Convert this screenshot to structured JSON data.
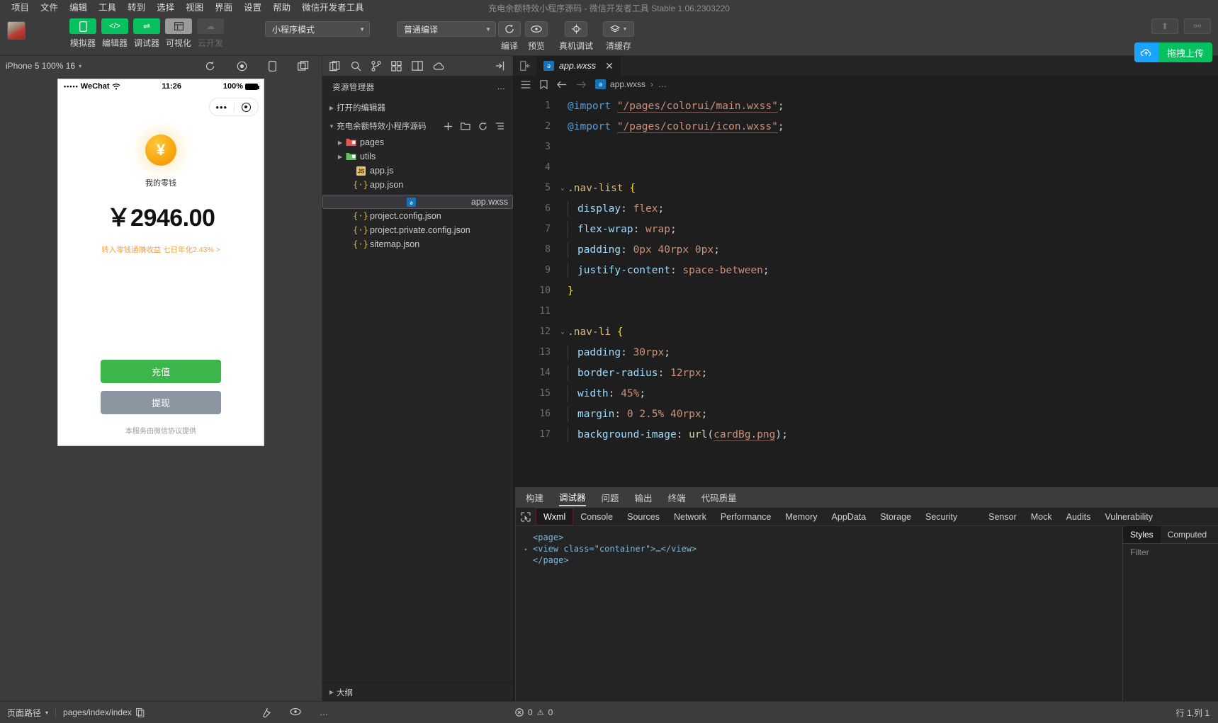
{
  "window": {
    "title": "充电余额特效小程序源码 - 微信开发者工具 Stable 1.06.2303220"
  },
  "menubar": {
    "items": [
      "项目",
      "文件",
      "编辑",
      "工具",
      "转到",
      "选择",
      "视图",
      "界面",
      "设置",
      "帮助",
      "微信开发者工具"
    ]
  },
  "toolbar": {
    "mode_buttons": [
      {
        "label": "模拟器",
        "icon": "phone-icon",
        "glyph": "▯",
        "style": "green"
      },
      {
        "label": "编辑器",
        "icon": "code-icon",
        "glyph": "</>",
        "style": "green"
      },
      {
        "label": "调试器",
        "icon": "debug-icon",
        "glyph": "⇌",
        "style": "green"
      },
      {
        "label": "可视化",
        "icon": "layout-icon",
        "glyph": "▤",
        "style": "grey"
      },
      {
        "label": "云开发",
        "icon": "cloud-icon",
        "glyph": "☁",
        "style": "dim"
      }
    ],
    "mode_select": {
      "value": "小程序模式",
      "caret": "▼"
    },
    "compile_select": {
      "value": "普通编译",
      "caret": "▼"
    },
    "action_buttons": [
      {
        "label": "编译",
        "icon": "refresh-icon",
        "glyph": "⟳"
      },
      {
        "label": "预览",
        "icon": "eye-icon",
        "glyph": "◉"
      },
      {
        "label": "真机调试",
        "icon": "bug-icon",
        "glyph": "✱"
      },
      {
        "label": "清缓存",
        "icon": "layers-icon",
        "glyph": "≋"
      }
    ],
    "upload_button": {
      "label": "拖拽上传",
      "icon": "cloud-upload-icon"
    },
    "right_icons": [
      {
        "icon": "upload-icon",
        "glyph": "⬆"
      },
      {
        "icon": "user-icon",
        "glyph": "⚯"
      }
    ]
  },
  "simulator": {
    "device_label": "iPhone 5 100% 16",
    "device_caret": "▾",
    "icons": [
      {
        "icon": "rotate-icon",
        "glyph": "⟳"
      },
      {
        "icon": "record-icon",
        "glyph": "◉"
      },
      {
        "icon": "device-icon",
        "glyph": "▯"
      },
      {
        "icon": "multi-window-icon",
        "glyph": "❐"
      }
    ],
    "status_bar": {
      "carrier_dots": "•••••",
      "carrier": "WeChat",
      "wifi": "⌃",
      "time": "11:26",
      "battery": "100%"
    },
    "capsule": {
      "dots": "•••",
      "target_icon": "target-icon"
    },
    "page": {
      "coin_icon": "yuan-coin-icon",
      "coin_glyph": "¥",
      "label": "我的零钱",
      "amount": "￥2946.00",
      "yield_line": "转入零钱通赚收益 七日年化2.43% >",
      "primary_button": "充值",
      "secondary_button": "提现",
      "footnote": "本服务由微信协议提供"
    }
  },
  "explorer": {
    "toolbar_icons": [
      {
        "icon": "files-icon",
        "glyph": "❐"
      },
      {
        "icon": "search-icon",
        "glyph": "⌕"
      },
      {
        "icon": "source-control-icon",
        "glyph": "⑂"
      },
      {
        "icon": "extensions-icon",
        "glyph": "⊞"
      },
      {
        "icon": "open-editors-icon",
        "glyph": "❏"
      },
      {
        "icon": "cloud-icon",
        "glyph": "☁"
      },
      {
        "icon": "collapse-icon",
        "glyph": "⇥"
      }
    ],
    "title": "资源管理器",
    "more_icon": "…",
    "sections": [
      {
        "label": "打开的编辑器",
        "expanded": false,
        "caret": "▶"
      },
      {
        "label": "充电余额特效小程序源码",
        "expanded": true,
        "caret": "▼",
        "actions": [
          {
            "icon": "new-file-icon",
            "glyph": "＋"
          },
          {
            "icon": "new-folder-icon",
            "glyph": "🗀"
          },
          {
            "icon": "refresh-icon",
            "glyph": "⟳"
          },
          {
            "icon": "collapse-all-icon",
            "glyph": "⇱"
          }
        ]
      }
    ],
    "files": [
      {
        "name": "pages",
        "type": "folder",
        "caret": "▶",
        "icon": "folder-red-icon",
        "indent": 1,
        "selected": false
      },
      {
        "name": "utils",
        "type": "folder",
        "caret": "▶",
        "icon": "folder-green-icon",
        "indent": 1,
        "selected": false
      },
      {
        "name": "app.js",
        "type": "js",
        "caret": "",
        "icon": "js-file-icon",
        "indent": 2,
        "selected": false
      },
      {
        "name": "app.json",
        "type": "json",
        "caret": "",
        "icon": "json-file-icon",
        "indent": 2,
        "selected": false
      },
      {
        "name": "app.wxss",
        "type": "wxss",
        "caret": "",
        "icon": "wxss-file-icon",
        "indent": 2,
        "selected": true
      },
      {
        "name": "project.config.json",
        "type": "json",
        "caret": "",
        "icon": "json-file-icon",
        "indent": 2,
        "selected": false
      },
      {
        "name": "project.private.config.json",
        "type": "json",
        "caret": "",
        "icon": "json-file-icon",
        "indent": 2,
        "selected": false
      },
      {
        "name": "sitemap.json",
        "type": "json",
        "caret": "",
        "icon": "json-file-icon",
        "indent": 2,
        "selected": false
      }
    ],
    "footer": {
      "label": "大纲",
      "caret": "▶"
    }
  },
  "editor": {
    "split_icon": "split-editor-icon",
    "tab": {
      "name": "app.wxss",
      "icon": "wxss-file-icon",
      "close": "✕"
    },
    "breadcrumb_icons": [
      {
        "icon": "list-icon",
        "glyph": "☰"
      },
      {
        "icon": "bookmark-icon",
        "glyph": "🔖"
      },
      {
        "icon": "back-arrow-icon",
        "glyph": "←"
      },
      {
        "icon": "forward-arrow-icon",
        "glyph": "→"
      }
    ],
    "breadcrumb": {
      "file": "app.wxss",
      "sep": "›",
      "trail": "…"
    },
    "lines": [
      {
        "n": 1,
        "fold": "",
        "tokens": [
          {
            "t": "@import",
            "c": "kw"
          },
          {
            "t": " ",
            "c": "pun"
          },
          {
            "t": "\"/pages/colorui/main.wxss\"",
            "c": "str underline"
          },
          {
            "t": ";",
            "c": "pun"
          }
        ]
      },
      {
        "n": 2,
        "fold": "",
        "tokens": [
          {
            "t": "@import",
            "c": "kw"
          },
          {
            "t": " ",
            "c": "pun"
          },
          {
            "t": "\"/pages/colorui/icon.wxss\"",
            "c": "str underline"
          },
          {
            "t": ";",
            "c": "pun"
          }
        ]
      },
      {
        "n": 3,
        "fold": "",
        "tokens": []
      },
      {
        "n": 4,
        "fold": "",
        "tokens": []
      },
      {
        "n": 5,
        "fold": "⌄",
        "tokens": [
          {
            "t": ".nav-list",
            "c": "sel-c"
          },
          {
            "t": " ",
            "c": "pun"
          },
          {
            "t": "{",
            "c": "brace"
          }
        ]
      },
      {
        "n": 6,
        "fold": "",
        "indent": 1,
        "tokens": [
          {
            "t": "display",
            "c": "prop"
          },
          {
            "t": ": ",
            "c": "pun"
          },
          {
            "t": "flex",
            "c": "val"
          },
          {
            "t": ";",
            "c": "pun"
          }
        ]
      },
      {
        "n": 7,
        "fold": "",
        "indent": 1,
        "tokens": [
          {
            "t": "flex-wrap",
            "c": "prop"
          },
          {
            "t": ": ",
            "c": "pun"
          },
          {
            "t": "wrap",
            "c": "val"
          },
          {
            "t": ";",
            "c": "pun"
          }
        ]
      },
      {
        "n": 8,
        "fold": "",
        "indent": 1,
        "tokens": [
          {
            "t": "padding",
            "c": "prop"
          },
          {
            "t": ": ",
            "c": "pun"
          },
          {
            "t": "0px 40rpx 0px",
            "c": "val"
          },
          {
            "t": ";",
            "c": "pun"
          }
        ]
      },
      {
        "n": 9,
        "fold": "",
        "indent": 1,
        "tokens": [
          {
            "t": "justify-content",
            "c": "prop"
          },
          {
            "t": ": ",
            "c": "pun"
          },
          {
            "t": "space-between",
            "c": "val"
          },
          {
            "t": ";",
            "c": "pun"
          }
        ]
      },
      {
        "n": 10,
        "fold": "",
        "tokens": [
          {
            "t": "}",
            "c": "brace"
          }
        ]
      },
      {
        "n": 11,
        "fold": "",
        "tokens": []
      },
      {
        "n": 12,
        "fold": "⌄",
        "tokens": [
          {
            "t": ".nav-li",
            "c": "sel-c"
          },
          {
            "t": " ",
            "c": "pun"
          },
          {
            "t": "{",
            "c": "brace"
          }
        ]
      },
      {
        "n": 13,
        "fold": "",
        "indent": 1,
        "tokens": [
          {
            "t": "padding",
            "c": "prop"
          },
          {
            "t": ": ",
            "c": "pun"
          },
          {
            "t": "30rpx",
            "c": "val"
          },
          {
            "t": ";",
            "c": "pun"
          }
        ]
      },
      {
        "n": 14,
        "fold": "",
        "indent": 1,
        "tokens": [
          {
            "t": "border-radius",
            "c": "prop"
          },
          {
            "t": ": ",
            "c": "pun"
          },
          {
            "t": "12rpx",
            "c": "val"
          },
          {
            "t": ";",
            "c": "pun"
          }
        ]
      },
      {
        "n": 15,
        "fold": "",
        "indent": 1,
        "tokens": [
          {
            "t": "width",
            "c": "prop"
          },
          {
            "t": ": ",
            "c": "pun"
          },
          {
            "t": "45%",
            "c": "val"
          },
          {
            "t": ";",
            "c": "pun"
          }
        ]
      },
      {
        "n": 16,
        "fold": "",
        "indent": 1,
        "tokens": [
          {
            "t": "margin",
            "c": "prop"
          },
          {
            "t": ": ",
            "c": "pun"
          },
          {
            "t": "0 2.5% 40rpx",
            "c": "val"
          },
          {
            "t": ";",
            "c": "pun"
          }
        ]
      },
      {
        "n": 17,
        "fold": "",
        "indent": 1,
        "tokens": [
          {
            "t": "background-image",
            "c": "prop"
          },
          {
            "t": ": ",
            "c": "pun"
          },
          {
            "t": "url",
            "c": "fn"
          },
          {
            "t": "(",
            "c": "pun"
          },
          {
            "t": "cardBg.png",
            "c": "val underline"
          },
          {
            "t": ")",
            "c": "pun"
          },
          {
            "t": ";",
            "c": "pun"
          }
        ]
      }
    ]
  },
  "devtools": {
    "top_tabs": [
      {
        "label": "构建",
        "active": false
      },
      {
        "label": "调试器",
        "active": true
      },
      {
        "label": "问题",
        "active": false
      },
      {
        "label": "输出",
        "active": false
      },
      {
        "label": "终端",
        "active": false
      },
      {
        "label": "代码质量",
        "active": false
      }
    ],
    "picker_icon": "element-picker-icon",
    "panel_tabs": [
      {
        "label": "Wxml",
        "active": true
      },
      {
        "label": "Console",
        "active": false
      },
      {
        "label": "Sources",
        "active": false
      },
      {
        "label": "Network",
        "active": false
      },
      {
        "label": "Performance",
        "active": false
      },
      {
        "label": "Memory",
        "active": false
      },
      {
        "label": "AppData",
        "active": false
      },
      {
        "label": "Storage",
        "active": false
      },
      {
        "label": "Security",
        "active": false
      },
      {
        "label": "Sensor",
        "active": false
      },
      {
        "label": "Mock",
        "active": false
      },
      {
        "label": "Audits",
        "active": false
      },
      {
        "label": "Vulnerability",
        "active": false
      }
    ],
    "wxml_lines": [
      {
        "twisty": "",
        "html": "&lt;page&gt;"
      },
      {
        "twisty": "▸",
        "html": "&lt;view class=\"container\"&gt;…&lt;/view&gt;"
      },
      {
        "twisty": "",
        "html": "&lt;/page&gt;"
      }
    ],
    "styles_tabs": [
      {
        "label": "Styles",
        "active": true
      },
      {
        "label": "Computed",
        "active": false
      }
    ],
    "filter_placeholder": "Filter"
  },
  "statusbar": {
    "path_label": "页面路径",
    "path_caret": "▾",
    "path_value": "pages/index/index",
    "copy_icon": "copy-icon",
    "right_icons": [
      {
        "icon": "devtools-icon",
        "glyph": "⚒"
      },
      {
        "icon": "eye-icon",
        "glyph": "◉"
      },
      {
        "icon": "more-icon",
        "glyph": "…"
      }
    ],
    "problems": {
      "error_icon": "error-icon",
      "errors": "0",
      "warn_icon": "⚠",
      "warnings": "0"
    },
    "line_col": "行 1,列 1"
  },
  "colors": {
    "accent_green": "#07c160",
    "accent_blue": "#1aa3ff",
    "coin_orange": "#f9a812",
    "editor_bg": "#1e1e1e"
  }
}
